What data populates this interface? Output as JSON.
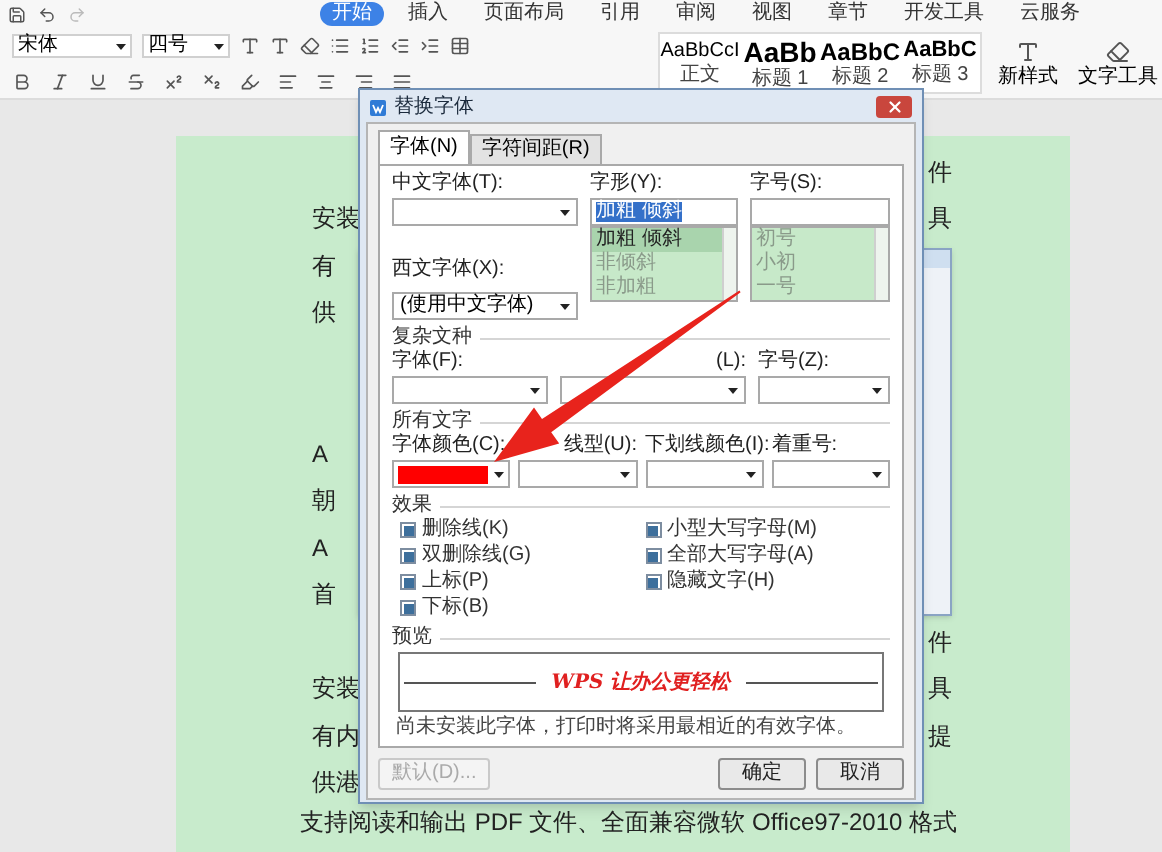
{
  "ribbon": {
    "tabs": [
      {
        "label": "开始",
        "selected": true
      },
      {
        "label": "插入",
        "selected": false
      },
      {
        "label": "页面布局",
        "selected": false
      },
      {
        "label": "引用",
        "selected": false
      },
      {
        "label": "审阅",
        "selected": false
      },
      {
        "label": "视图",
        "selected": false
      },
      {
        "label": "章节",
        "selected": false
      },
      {
        "label": "开发工具",
        "selected": false
      },
      {
        "label": "云服务",
        "selected": false
      }
    ],
    "font_name": "宋体",
    "font_size": "四号",
    "styles": [
      {
        "preview": "AaBbCcI",
        "label": "正文",
        "kind": "normal"
      },
      {
        "preview": "AaBb",
        "label": "标题 1",
        "kind": "h1"
      },
      {
        "preview": "AaBbC",
        "label": "标题 2",
        "kind": "h2"
      },
      {
        "preview": "AaBbC",
        "label": "标题 3",
        "kind": "h3"
      }
    ],
    "new_style": "新样式",
    "text_tool": "文字工具"
  },
  "document": {
    "lines": [
      {
        "right": "件"
      },
      {
        "left": "安装",
        "right": "具"
      },
      {
        "left": "有"
      },
      {
        "left": "供"
      },
      {
        "kind": "gap"
      },
      {
        "left": "A"
      },
      {
        "left": "朝"
      },
      {
        "left": "A"
      },
      {
        "left": "首"
      },
      {
        "right": "件"
      },
      {
        "left": "安装",
        "right": "具"
      },
      {
        "left": "有内",
        "right": "提"
      },
      {
        "left": "供港"
      }
    ],
    "last_line": "支持阅读和输出 PDF 文件、全面兼容微软 Office97-2010 格式"
  },
  "dialog": {
    "title": "替换字体",
    "tabs": [
      {
        "label": "字体(N)",
        "selected": true
      },
      {
        "label": "字符间距(R)",
        "selected": false
      }
    ],
    "chinese_font": {
      "label": "中文字体(T):"
    },
    "style": {
      "label": "字形(Y):",
      "value": "加粗 倾斜",
      "options": [
        {
          "label": "加粗 倾斜",
          "selected": true
        },
        {
          "label": "非倾斜",
          "selected": false
        },
        {
          "label": "非加粗",
          "selected": false
        }
      ]
    },
    "size": {
      "label": "字号(S):",
      "options": [
        {
          "label": "初号",
          "selected": false
        },
        {
          "label": "小初",
          "selected": false
        },
        {
          "label": "一号",
          "selected": false
        }
      ]
    },
    "western_font": {
      "label": "西文字体(X):",
      "value": "(使用中文字体)"
    },
    "complex_section": "复杂文种",
    "complex_fields": [
      {
        "label": "字体(F):"
      },
      {
        "label": "(L):",
        "kind": "obscured"
      },
      {
        "label": "字号(Z):"
      }
    ],
    "all_text_section": "所有文字",
    "all_text_fields": [
      {
        "label": "字体颜色(C):",
        "color": "#ff0000"
      },
      {
        "label": "线型(U):",
        "kind": "obscured"
      },
      {
        "label": "下划线颜色(I):"
      },
      {
        "label": "着重号:"
      }
    ],
    "effects_section": "效果",
    "effects": [
      {
        "label": "删除线(K)",
        "indeterminate": true
      },
      {
        "label": "小型大写字母(M)",
        "indeterminate": true
      },
      {
        "label": "双删除线(G)",
        "indeterminate": true
      },
      {
        "label": "全部大写字母(A)",
        "indeterminate": true
      },
      {
        "label": "上标(P)",
        "indeterminate": true
      },
      {
        "label": "隐藏文字(H)",
        "indeterminate": true
      },
      {
        "label": "下标(B)",
        "indeterminate": true
      }
    ],
    "preview_section": "预览",
    "preview_text": "WPS 让办公更轻松",
    "note": "尚未安装此字体，打印时将采用最相近的有效字体。",
    "buttons": [
      {
        "label": "默认(D)...",
        "disabled": true
      },
      {
        "label": "确定",
        "disabled": false
      },
      {
        "label": "取消",
        "disabled": false
      }
    ]
  }
}
